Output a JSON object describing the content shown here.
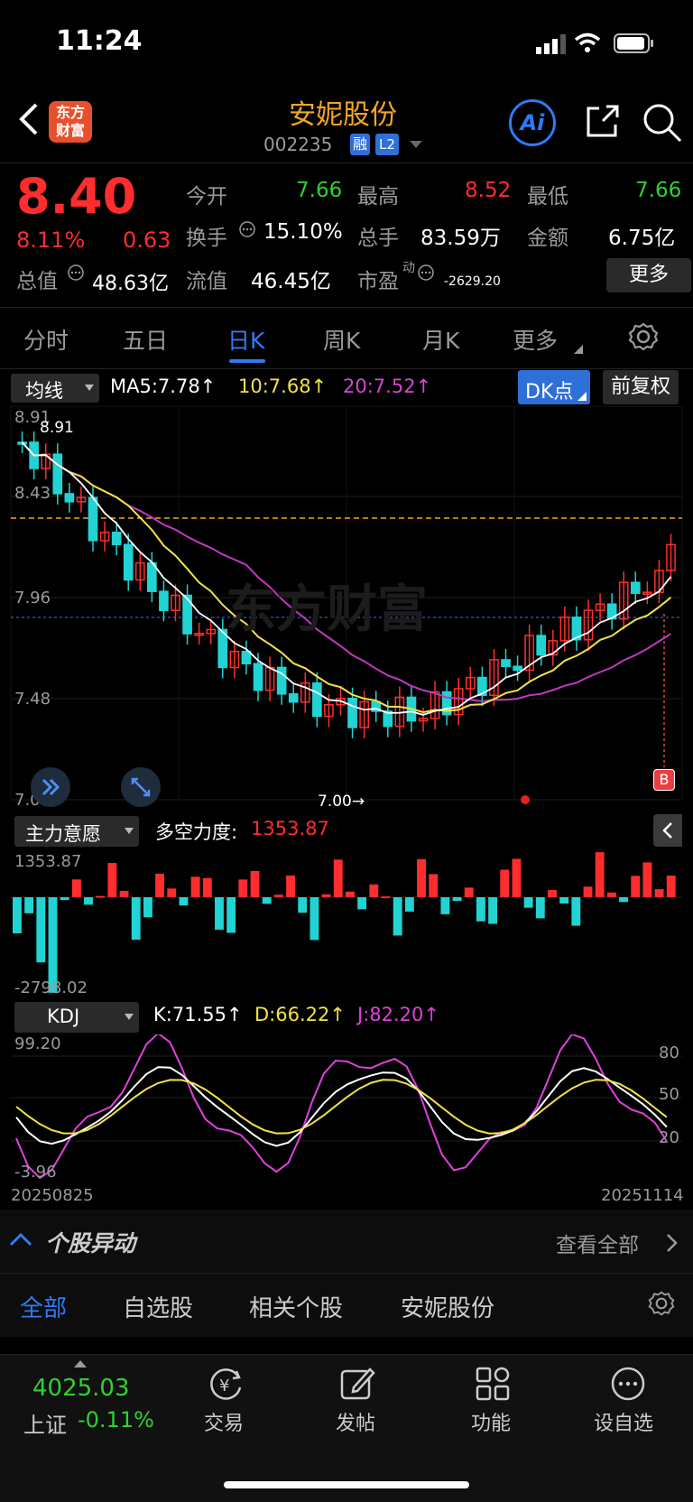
{
  "status_bar": {
    "time": "11:24"
  },
  "header": {
    "logo_text": "东方\n财富",
    "title": "安妮股份",
    "code": "002235",
    "badge_margin": "融",
    "badge_level": "L2",
    "ai_label": "Ai"
  },
  "quote": {
    "price": "8.40",
    "change_pct": "8.11%",
    "change_abs": "0.63",
    "open_label": "今开",
    "open": "7.66",
    "high_label": "最高",
    "high": "8.52",
    "low_label": "最低",
    "low": "7.66",
    "turnover_rate_label": "换手",
    "turnover_rate": "15.10%",
    "volume_label": "总手",
    "volume": "83.59万",
    "amount_label": "金额",
    "amount": "6.75亿",
    "market_cap_label": "总值",
    "market_cap": "48.63亿",
    "float_cap_label": "流值",
    "float_cap": "46.45亿",
    "pe_label": "市盈",
    "pe_sup": "动",
    "pe": "-2629.20",
    "more_label": "更多"
  },
  "tabs": [
    "分时",
    "五日",
    "日K",
    "周K",
    "月K",
    "更多"
  ],
  "active_tab": 2,
  "kline": {
    "indicator_select": "均线",
    "ma5": "MA5:7.78↑",
    "ma10": "10:7.68↑",
    "ma20": "20:7.52↑",
    "dk_button": "DK点",
    "fq_button": "前复权",
    "y_labels": [
      "8.91",
      "8.43",
      "7.96",
      "7.48",
      "7.00"
    ],
    "max_label": "8.91",
    "min_label": "7.00→",
    "watermark": "东方财富",
    "signal_b": "B"
  },
  "main_force": {
    "select": "主力意愿",
    "label": "多空力度:",
    "value": "1353.87",
    "y_top": "1353.87",
    "y_bottom": "-2798.02"
  },
  "kdj": {
    "select": "KDJ",
    "k": "K:71.55↑",
    "d": "D:66.22↑",
    "j": "J:82.20↑",
    "y_top": "99.20",
    "y_bottom": "-3.96",
    "levels": [
      "80",
      "50",
      "20"
    ],
    "date_start": "20250825",
    "date_end": "20251114"
  },
  "anomaly": {
    "title": "个股异动",
    "view_all": "查看全部"
  },
  "filter_tabs": [
    "全部",
    "自选股",
    "相关个股",
    "安妮股份"
  ],
  "bottom_bar": {
    "index_value": "4025.03",
    "index_name": "上证",
    "index_change": "-0.11%",
    "items": [
      "交易",
      "发帖",
      "功能",
      "设自选"
    ]
  },
  "colors": {
    "up": "#ff2d2d",
    "down": "#22d3d3",
    "ma5": "#ffffff",
    "ma10": "#f2e24a",
    "ma20": "#c238c2",
    "accent": "#2f7bf5",
    "gold": "#f5a623"
  }
}
